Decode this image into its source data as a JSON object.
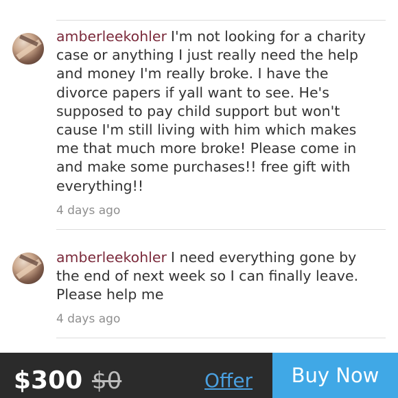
{
  "comments": [
    {
      "username": "amberleekohler",
      "text": "I'm not looking for a charity case or anything I just really need the help and money I'm really broke. I have the divorce papers if yall want to see. He's supposed to pay child support but won't cause I'm still living with him which makes me that much more broke! Please come in and make some purchases!! free gift with everything!!",
      "timestamp": "4 days ago"
    },
    {
      "username": "amberleekohler",
      "text": "I need everything gone by the end of next week so I can finally leave. Please help me",
      "timestamp": "4 days ago"
    }
  ],
  "footer": {
    "price": "$300",
    "original_price": "$0",
    "offer_label": "Offer",
    "buy_label": "Buy Now"
  },
  "icons": {
    "top": "heart-like-icon"
  },
  "colors": {
    "username": "#7b2a3b",
    "accent_blue": "#40a8e6",
    "footer_bg": "#2b2b2b"
  }
}
